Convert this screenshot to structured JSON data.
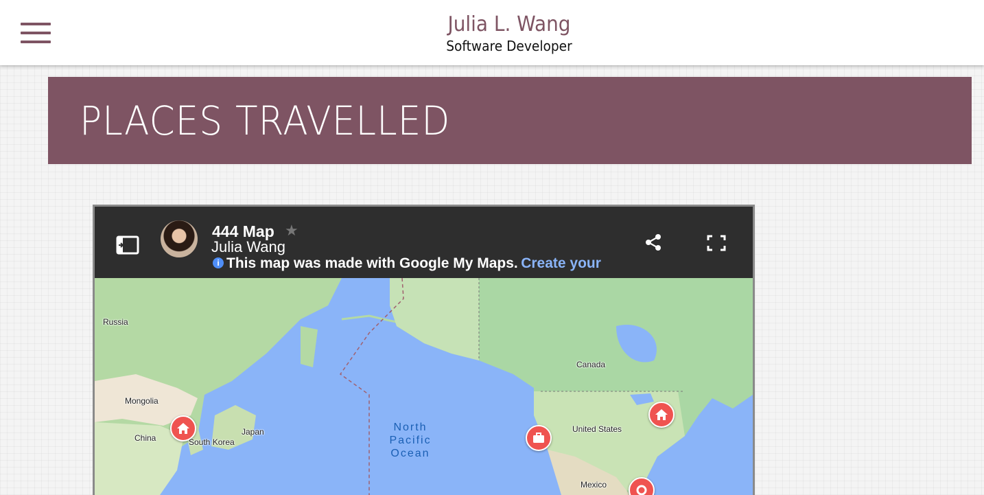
{
  "header": {
    "name": "Julia L. Wang",
    "role": "Software Developer",
    "menu_icon": "hamburger-menu-icon"
  },
  "banner": {
    "title": "PLACES TRAVELLED"
  },
  "map": {
    "title": "444 Map",
    "author": "Julia Wang",
    "info_text": "This map was made with Google My Maps.",
    "info_link": "Create your",
    "icons": [
      "sidebar-toggle-icon",
      "star-icon",
      "info-icon",
      "share-icon",
      "fullscreen-icon"
    ],
    "place_labels": [
      "Russia",
      "Mongolia",
      "China",
      "South Korea",
      "Japan",
      "Canada",
      "United States",
      "Mexico"
    ],
    "ocean_label": {
      "line1": "North",
      "line2": "Pacific",
      "line3": "Ocean"
    },
    "markers": [
      {
        "icon": "home-icon",
        "near": "South Korea"
      },
      {
        "icon": "briefcase-icon",
        "near": "United States west coast"
      },
      {
        "icon": "home-icon",
        "near": "United States east coast"
      },
      {
        "icon": "marker-icon",
        "near": "Mexico"
      }
    ],
    "colors": {
      "water": "#8ab4f8",
      "land": "#a8d8b0",
      "marker": "#ef5350",
      "header": "#2e2e2e"
    }
  },
  "colors": {
    "accent": "#7e5463"
  }
}
